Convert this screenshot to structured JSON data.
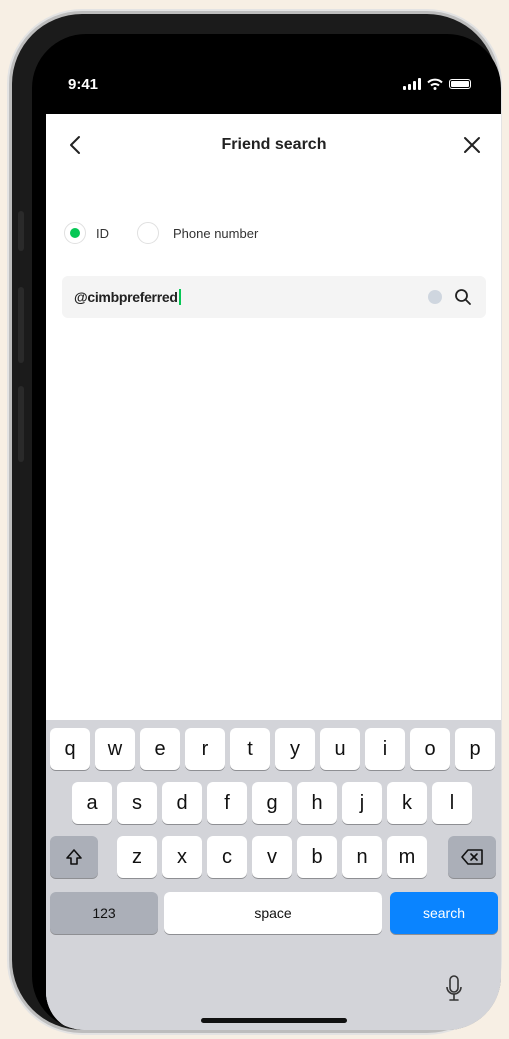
{
  "status_bar": {
    "time": "9:41"
  },
  "nav": {
    "title": "Friend search"
  },
  "search_type": {
    "options": [
      {
        "label": "ID",
        "selected": true
      },
      {
        "label": "Phone number",
        "selected": false
      }
    ]
  },
  "search": {
    "value": "@cimbpreferred"
  },
  "keyboard": {
    "row1": [
      "q",
      "w",
      "e",
      "r",
      "t",
      "y",
      "u",
      "i",
      "o",
      "p"
    ],
    "row2": [
      "a",
      "s",
      "d",
      "f",
      "g",
      "h",
      "j",
      "k",
      "l"
    ],
    "row3": [
      "z",
      "x",
      "c",
      "v",
      "b",
      "n",
      "m"
    ],
    "numbers_label": "123",
    "space_label": "space",
    "search_label": "search"
  },
  "colors": {
    "accent_green": "#06c755",
    "key_blue": "#0a84ff"
  }
}
